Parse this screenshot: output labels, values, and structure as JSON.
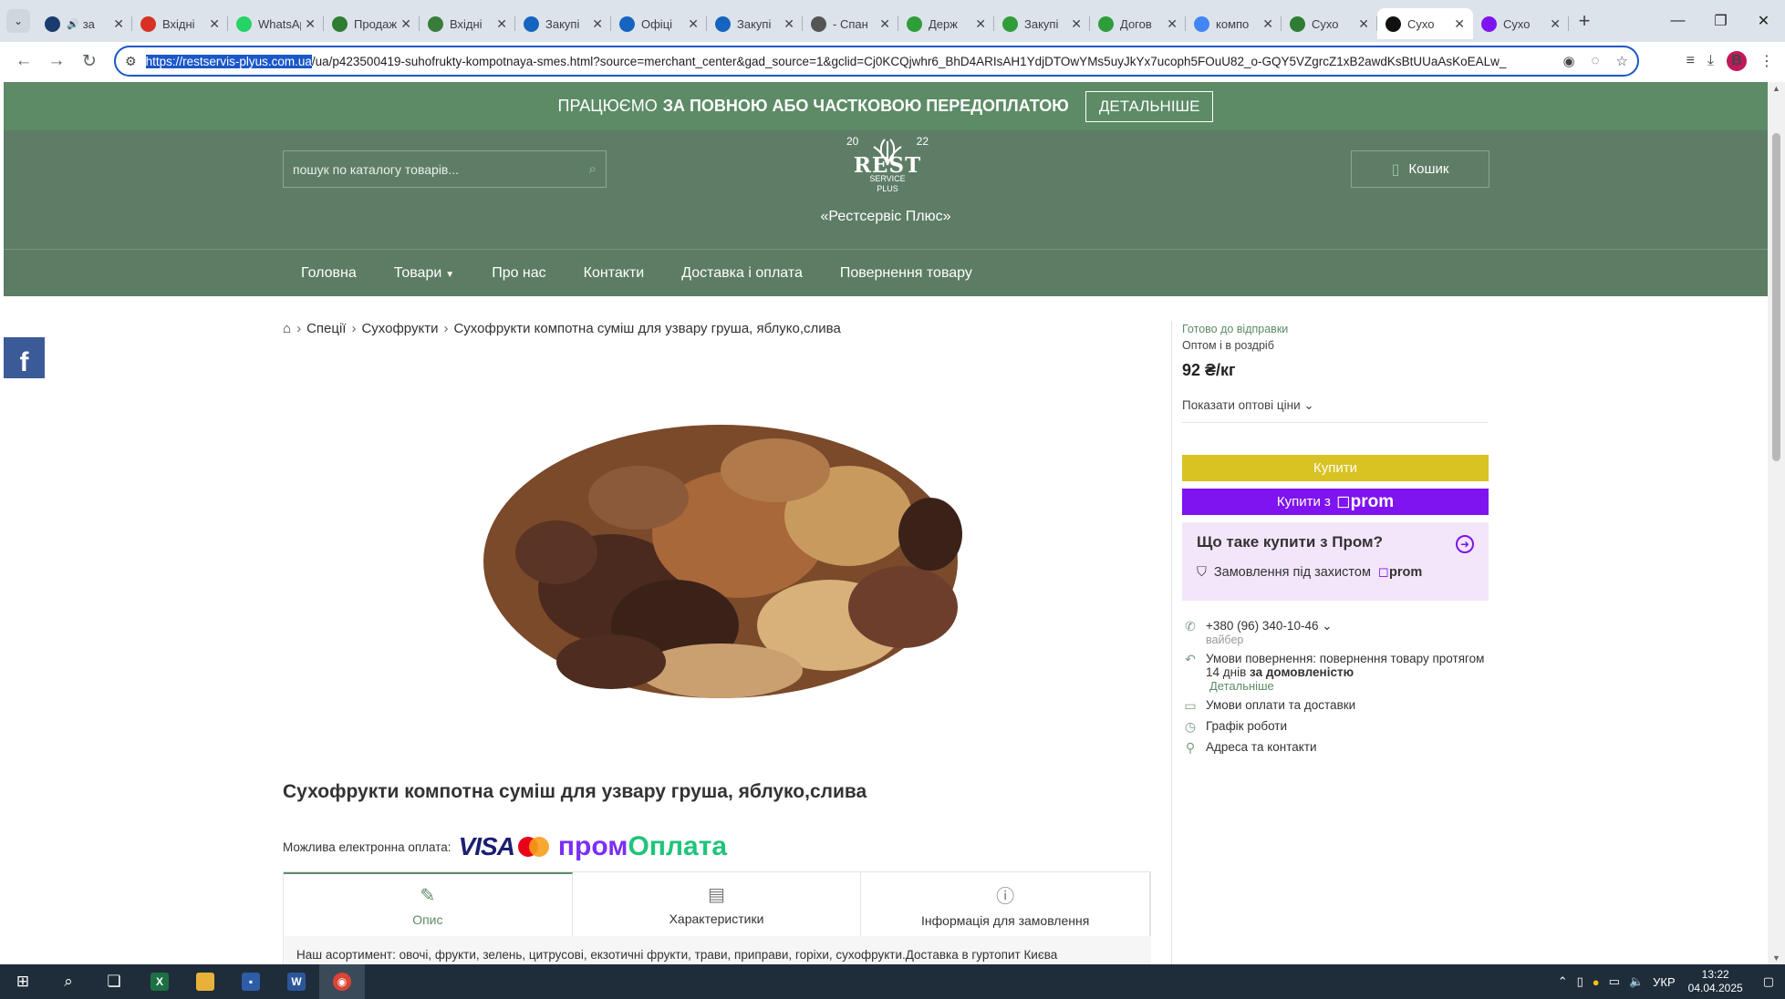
{
  "browser": {
    "tabs": [
      {
        "label": "за",
        "icon": "globe-icon",
        "color": "#1a3b6e",
        "extra": "audio-icon"
      },
      {
        "label": "Вхідні",
        "icon": "gmail-icon",
        "color": "#d93025"
      },
      {
        "label": "WhatsApp",
        "icon": "whatsapp-icon",
        "color": "#25d366"
      },
      {
        "label": "Продаж",
        "icon": "prozorro-icon",
        "color": "#2e7d32"
      },
      {
        "label": "Вхідні",
        "icon": "mail-icon",
        "color": "#3a7d3a"
      },
      {
        "label": "Закупі",
        "icon": "ua-icon",
        "color": "#1565c0"
      },
      {
        "label": "Офіці",
        "icon": "ua-icon",
        "color": "#1565c0"
      },
      {
        "label": "Закупі",
        "icon": "ua-icon",
        "color": "#1565c0"
      },
      {
        "label": "- Спан",
        "icon": "globe-icon",
        "color": "#555"
      },
      {
        "label": "Держ",
        "icon": "prozorro-icon",
        "color": "#2e9d3a"
      },
      {
        "label": "Закупі",
        "icon": "prozorro-icon",
        "color": "#2e9d3a"
      },
      {
        "label": "Догов",
        "icon": "prozorro-icon",
        "color": "#2e9d3a"
      },
      {
        "label": "компо",
        "icon": "google-icon",
        "color": "#4285f4"
      },
      {
        "label": "Сухо",
        "icon": "rest-icon",
        "color": "#2e7d32"
      },
      {
        "label": "Сухо",
        "icon": "rest-icon",
        "color": "#111",
        "active": true
      },
      {
        "label": "Сухо",
        "icon": "prom-icon",
        "color": "#7f14f0"
      }
    ],
    "url_host": "https://restservis-plyus.com.ua",
    "url_rest": "/ua/p423500419-suhofrukty-kompotnaya-smes.html?source=merchant_center&gad_source=1&gclid=Cj0KCQjwhr6_BhD4ARIsAH1YdjDTOwYMs5uyJkYx7ucoph5FOuU82_o-GQY5VZgrcZ1xB2awdKsBtUUaAsKoEALw_",
    "profile_initial": "B"
  },
  "promo": {
    "text_regular": "ПРАЦЮЄМО",
    "text_bold": "ЗА ПОВНОЮ АБО ЧАСТКОВОЮ ПЕРЕДОПЛАТОЮ",
    "button": "ДЕТАЛЬНІШЕ"
  },
  "header": {
    "search_placeholder": "пошук по каталогу товарів...",
    "logo_year_left": "20",
    "logo_year_right": "22",
    "logo_main": "REST",
    "logo_sub1": "SERVICE",
    "logo_sub2": "PLUS",
    "brand": "«Рестсервіс Плюс»",
    "cart": "Кошик"
  },
  "menu": [
    "Головна",
    "Товари",
    "Про нас",
    "Контакти",
    "Доставка і оплата",
    "Повернення товару"
  ],
  "breadcrumbs": [
    "Спеції",
    "Сухофрукти",
    "Сухофрукти компотна суміш для узвару груша, яблуко,слива"
  ],
  "product": {
    "title": "Сухофрукти компотна суміш для узвару груша, яблуко,слива",
    "pay_label": "Можлива електронна оплата:",
    "visa": "VISA",
    "prompay_1": "пром",
    "prompay_2": "Оплата",
    "tabs": [
      "Опис",
      "Характеристики",
      "Інформація для замовлення"
    ],
    "description": "Наш асортимент: овочі, фрукти, зелень, цитрусові, екзотичні фрукти, трави, приправи, горіхи, сухофрукти.Доставка в гуртопит  Києва"
  },
  "buybox": {
    "status": "Готово до відправки",
    "sale_type": "Оптом і в роздріб",
    "price": "92 ₴/кг",
    "wholesale_link": "Показати оптові ціни",
    "buy": "Купити",
    "buy_prom_prefix": "Купити з",
    "buy_prom_brand": "prom",
    "whatprom_title": "Що таке купити з Пром?",
    "protected": "Замовлення під захистом",
    "protected_brand": "prom",
    "phone": "+380 (96) 340-10-46",
    "phone_note": "вайбер",
    "return_text": "Умови повернення: повернення товару протягом 14 днів",
    "return_bold": "за домовленістю",
    "return_link": "Детальніше",
    "pay_delivery": "Умови оплати та доставки",
    "schedule": "Графік роботи",
    "address": "Адреса та контакти"
  },
  "taskbar": {
    "lang": "УКР",
    "time": "13:22",
    "date": "04.04.2025"
  }
}
